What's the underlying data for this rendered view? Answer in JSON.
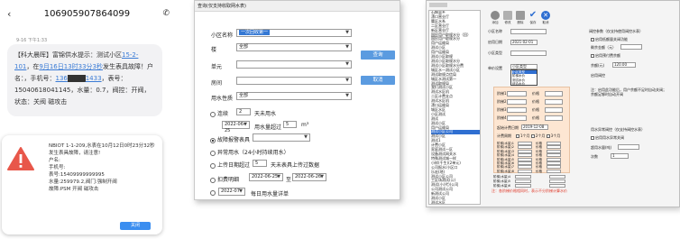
{
  "sms": {
    "phone": "106905907864099",
    "date": "9-16 下午1:33",
    "body_pre": "【科大晨晖】富锦供水提示：测试小区",
    "body_link1": "15-2-101",
    "body_mid1": "，在",
    "body_link2": "9月16日13时33分3秒",
    "body_mid2": "发生表具故障！户名：",
    "body_mid3": "，手机号：",
    "body_link3": "136",
    "body_link4": "1433",
    "body_post": "，表号：15040618041145，水量：0.7，阀控：开阀，状态：关阀 磁攻击"
  },
  "alert": {
    "l1": "NBIOT 1-1-209,水表在10月12日0时23分32秒",
    "l2": "发生表具故障，请注意!",
    "l3": "户名:",
    "l4": "手机号:",
    "l5": "表号:15409999999995",
    "l6": "水量:259979.2,阀门:强制开阀",
    "l7": "故障:PSM 开阀 磁攻击",
    "close": "关闭"
  },
  "query": {
    "title": "查询(仅支持收取网水表)",
    "community_label": "小区名称",
    "community_value": "一次回收第一",
    "building_label": "楼",
    "building_value": "全部",
    "unit_label": "单元",
    "room_label": "房间",
    "nature_label": "用水性质",
    "nature_value": "全部",
    "query_btn": "查询",
    "cancel_btn": "取消",
    "opt_continuous": "连续",
    "continuous_days": "2",
    "continuous_suffix": "天未用水",
    "date1": "2022-06-25",
    "over_label": "用水量超过",
    "over_value": "5",
    "over_unit": "m³",
    "opt_fault": "故障报警表具",
    "opt_abnormal": "异常用水（24小时持续用水）",
    "opt_upload": "上传日期超过",
    "upload_value": "5",
    "upload_suffix": "天未表具上传过数据",
    "opt_deduct": "扣费明细",
    "deduct_from": "2022-06-25",
    "deduct_to_label": "至",
    "deduct_to": "2022-06-26",
    "month_value": "2022-07",
    "month_suffix": "每日用水量详单"
  },
  "app": {
    "toolbar": [
      "添加",
      "修改",
      "删除",
      "保存",
      "取消"
    ],
    "tree": [
      "石棉县乡",
      "漂口营业厅",
      "腰区水系",
      "二区营业厅",
      "新区营业厅",
      "国民用户取规水分（回）",
      "国民用户取规水分",
      "用户运维局",
      "测试小区",
      "用户运维局",
      "测试小区取规",
      "测试小区取规水分",
      "测试小区取规水分费",
      "城区水一测试小区",
      "测试取规点信局",
      "城区水测试第一",
      "测试取规局",
      "我们测试小区",
      "测试水区机",
      "二区计费支点",
      "测试水区机",
      "漂口运维局",
      "城区水区",
      "小区测试",
      "测试",
      "测试小区",
      "用户运维局",
      "测试小区公司",
      "测试小区",
      "测试1",
      "计费小区",
      "家庭测试一区",
      "设备测试网关水",
      "特殊测试城一样",
      "小样(千生)(2单元)",
      "公司报水/小区口",
      "乐宏(地)",
      "测试小区公司",
      "工区场测试(公)",
      "测试(小(代)(公司",
      "公司测试公司",
      "新测试公司",
      "测试小区",
      "测试水区",
      "测试小区",
      "城区水测试",
      "测试地区",
      "测试小区",
      "水测区",
      "测试城区区水",
      "测试小区",
      "测试城区",
      "测试网关"
    ],
    "field_name": "小区名称",
    "field_start": "启用日期",
    "start_date": "2021-02-01",
    "field_type": "小区类型",
    "price_label": "单价设置",
    "dropdown_value": "小区类型",
    "dropdown_options": [
      "小区类型",
      "阶梯水价",
      "测试水价",
      "综合水价"
    ],
    "rate_labels": [
      "阶梯1",
      "阶梯2",
      "阶梯3",
      "阶梯4"
    ],
    "rate_values": [
      "",
      "价格",
      "",
      ""
    ],
    "date_label": "起始计费日期",
    "date_value": "2019-12-08",
    "cycle_label": "计费周期",
    "cycle_opts": [
      "1个月",
      "2个月",
      "3个月"
    ],
    "adj_rows": [
      "阶梯(水量)1",
      "阶梯(水量)2",
      "阶梯(水量)3",
      "阶梯(水量)4",
      "阶梯(水量)5",
      "阶梯(水量)6",
      "阶梯(水量)7",
      "阶梯(水量)8"
    ],
    "price_col": "价格",
    "bottom_rows": [
      "阶梯(水量)4",
      "阶梯(水量)5",
      "阶梯(水量)6"
    ],
    "warning": "注：各阶梯价格相同时，表示不分阶梯计算水价",
    "right_title": "阀控参数（仅支持使用阀控水表）",
    "right_cb1": "启用低额量关阀功能",
    "right_label1": "剩余金额（元）",
    "right_cb2": "启用预付费余额",
    "right_label2": "余额(元)",
    "right_value2": "120.00",
    "right_label3": "启用阀控",
    "right_note": "注：启用此功能后，用户余额不足时自动关阀；余额足够时自动开阀",
    "right_title2": "用水异常阀控（仅支持阀控水表）",
    "right_cb3": "启用用水异常关阀",
    "right_label4": "超用水量(吨)",
    "right_label5": "次数",
    "right_value5": "1"
  }
}
